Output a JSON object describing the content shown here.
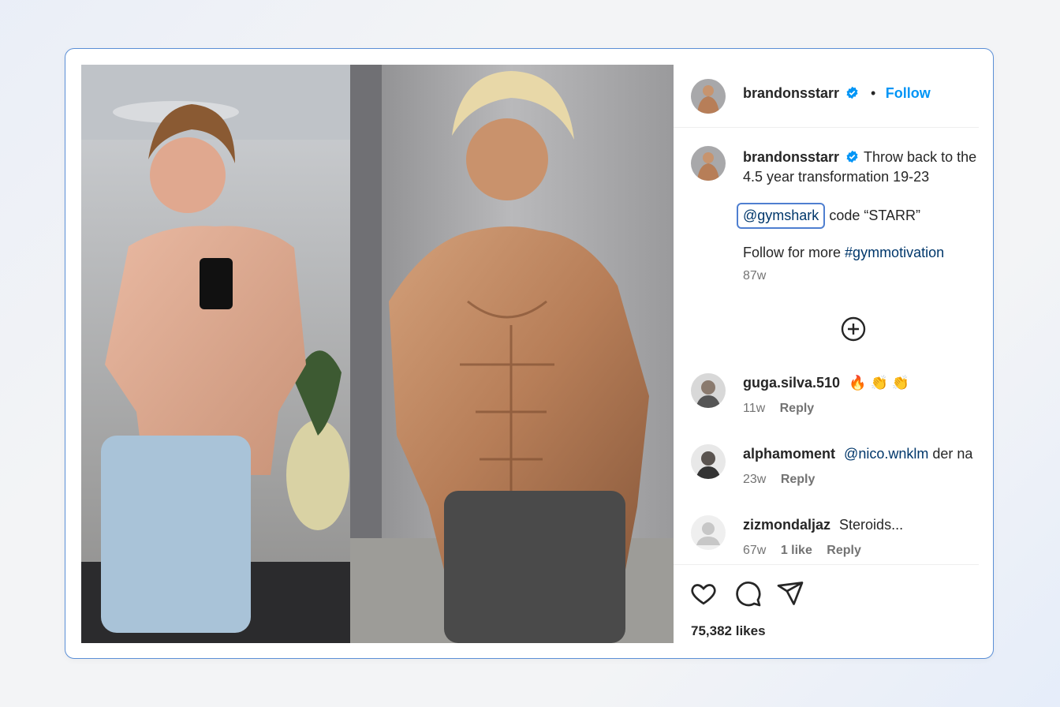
{
  "post": {
    "author": "brandonsstarr",
    "follow_label": "Follow",
    "separator": "•",
    "caption": {
      "username": "brandonsstarr",
      "line1": "Throw back to the",
      "line2": "4.5 year transformation 19-23",
      "mention": "@gymshark",
      "code_text": "code “STARR”",
      "follow_text": "Follow for more",
      "hashtag": "#gymmotivation",
      "age": "87w"
    },
    "likes": "75,382 likes"
  },
  "comments": [
    {
      "username": "guga.silva.510",
      "text": "🔥 👏 👏",
      "age": "11w",
      "likes": "",
      "reply": "Reply"
    },
    {
      "username": "alphamoment",
      "mention": "@nico.wnklm",
      "text": "der na",
      "age": "23w",
      "likes": "",
      "reply": "Reply"
    },
    {
      "username": "zizmondaljaz",
      "text": "Steroids...",
      "age": "67w",
      "likes": "1 like",
      "reply": "Reply"
    }
  ],
  "colors": {
    "accent": "#0095f6",
    "link": "#00376b",
    "verified": "#0095f6",
    "highlight_border": "#4f7fd0"
  },
  "icons": {
    "like": "heart-icon",
    "comment": "comment-icon",
    "share": "send-icon",
    "load_more": "plus-circle-icon",
    "verified": "verified-badge-icon"
  }
}
